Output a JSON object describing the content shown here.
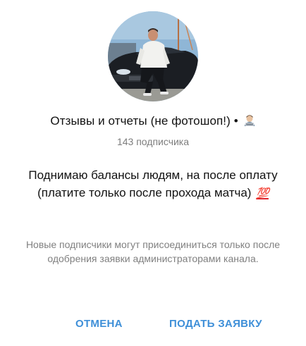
{
  "channel": {
    "title": "Отзывы и отчеты (не фотошоп!) •",
    "title_emoji": "technologist-emoji",
    "subscribers": "143 подписчика",
    "description_text": "Поднимаю балансы людям, на после оплату (платите только после прохода матча)",
    "description_emoji": "💯"
  },
  "notice": "Новые подписчики могут присоединиться только после одобрения заявки администраторами канала.",
  "buttons": {
    "cancel": "ОТМЕНА",
    "apply": "ПОДАТЬ ЗАЯВКУ"
  },
  "colors": {
    "accent": "#3e8fd8",
    "secondary_text": "#808080"
  }
}
